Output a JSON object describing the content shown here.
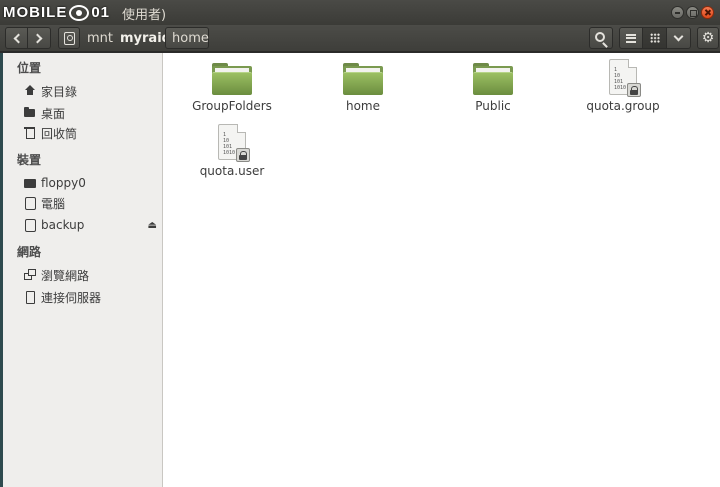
{
  "watermark": {
    "text_left": "MOBILE",
    "text_right": "01"
  },
  "window": {
    "title_partial": "使用者)"
  },
  "breadcrumb": {
    "segments": [
      "mnt",
      "myraid",
      "home"
    ]
  },
  "sidebar": {
    "sections": [
      {
        "title": "位置",
        "items": [
          "家目錄",
          "桌面",
          "回收筒"
        ]
      },
      {
        "title": "裝置",
        "items": [
          "floppy0",
          "電腦",
          "backup"
        ]
      },
      {
        "title": "網路",
        "items": [
          "瀏覽網路",
          "連接伺服器"
        ]
      }
    ]
  },
  "files": [
    {
      "name": "GroupFolders",
      "type": "folder"
    },
    {
      "name": "home",
      "type": "folder"
    },
    {
      "name": "Public",
      "type": "folder"
    },
    {
      "name": "quota.group",
      "type": "locked-binary-file"
    },
    {
      "name": "quota.user",
      "type": "locked-binary-file"
    }
  ],
  "file_icon_text": "1\n10\n101\n1010",
  "icons": {
    "back": "chevron-left-icon",
    "forward": "chevron-right-icon",
    "search": "search-icon",
    "list_view": "list-view-icon",
    "grid_view": "grid-view-icon",
    "options": "chevron-down-icon",
    "settings": "gear-icon"
  },
  "colors": {
    "folder_green": "#7a9a50",
    "close_button": "#df4a1c",
    "titlebar": "#3b3b37"
  }
}
